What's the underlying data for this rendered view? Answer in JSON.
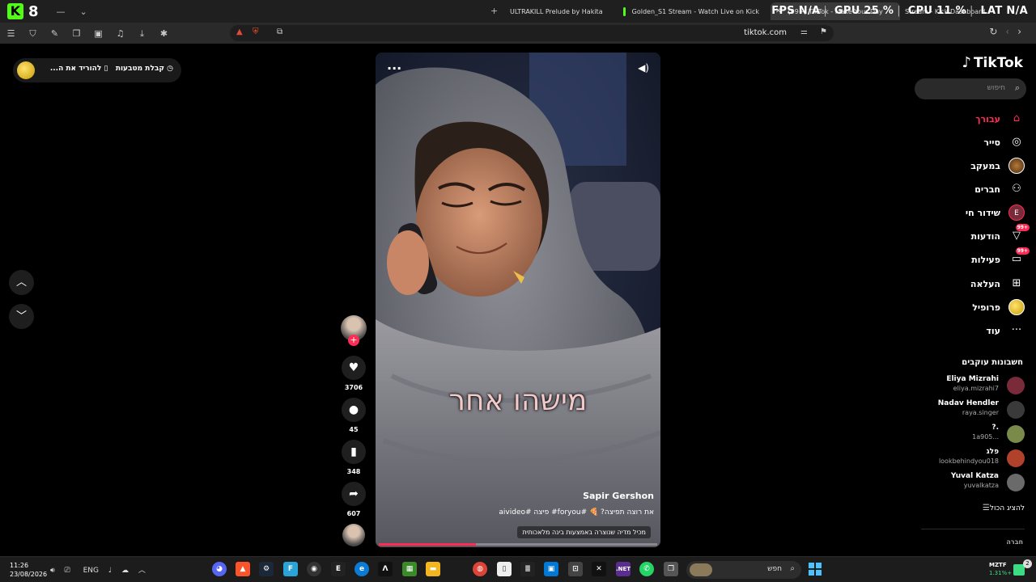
{
  "browser": {
    "kick_number": "8",
    "tabs": [
      {
        "label": "ULTRAKILL Prelude by Hakita",
        "color": "#9aa0a6"
      },
      {
        "label": "Golden_S1 Stream - Watch Live on Kick",
        "color": "#53fc18"
      },
      {
        "label": "(99+) TikTok - Make Your Day",
        "color": "#000000"
      },
      {
        "label": "Stream - Kick Dashboard",
        "color": "#53fc18"
      }
    ],
    "stats": {
      "fps_label": "FPS",
      "fps": "N/A",
      "gpu_label": "GPU",
      "gpu": "25 %",
      "cpu_label": "CPU",
      "cpu": "11 %",
      "lat_label": "LAT",
      "lat": "N/A"
    },
    "url": "tiktok.com"
  },
  "coin_pill": {
    "collect": "קבלת מטבעות",
    "download": "להוריד את ה..."
  },
  "video": {
    "caption": "מישהו אחר",
    "author": "Sapir Gershon",
    "description": "את רוצה תפיצה? 🍕 #foryou# פיצה #aivideo",
    "ai_notice": "מכיל מדיה שנוצרה באמצעות בינה מלאכותית",
    "progress": 0.35
  },
  "actions": {
    "likes": "3706",
    "comments": "45",
    "saves": "348",
    "shares": "607"
  },
  "sidebar": {
    "logo": "TikTok",
    "search_placeholder": "חיפוש",
    "items": [
      {
        "label": "עבורך",
        "icon": "home-icon",
        "glyph": "⌂"
      },
      {
        "label": "סייר",
        "icon": "compass-icon",
        "glyph": "◎"
      },
      {
        "label": "במעקב",
        "icon": "following-avatar-icon",
        "glyph": ""
      },
      {
        "label": "חברים",
        "icon": "friends-icon",
        "glyph": "⚇"
      },
      {
        "label": "שידור חי",
        "icon": "live-icon",
        "glyph": "E"
      },
      {
        "label": "הודעות",
        "icon": "messages-icon",
        "glyph": "▽",
        "badge": "99+"
      },
      {
        "label": "פעילות",
        "icon": "activity-icon",
        "glyph": "▭",
        "badge": "99+"
      },
      {
        "label": "העלאה",
        "icon": "upload-icon",
        "glyph": "⊞"
      },
      {
        "label": "פרופיל",
        "icon": "profile-icon",
        "glyph": ""
      },
      {
        "label": "עוד",
        "icon": "more-icon",
        "glyph": "···"
      }
    ],
    "following_title": "חשבונות עוקבים",
    "accounts": [
      {
        "name": "Eliya Mizrahi",
        "handle": "eliya.mizrahi7",
        "color": "#7a2b3a"
      },
      {
        "name": "Nadav Hendler",
        "handle": "raya.singer",
        "color": "#3a3a3a"
      },
      {
        "name": "?.",
        "handle": "1a905...",
        "color": "#7a8a4a"
      },
      {
        "name": "פלג",
        "handle": "lookbehindyou018",
        "color": "#b0412a"
      },
      {
        "name": "Yuval Katza",
        "handle": "yuvalkatza",
        "color": "#6a6a6a"
      }
    ],
    "show_all": "להציג הכול",
    "company": "חברה"
  },
  "taskbar": {
    "time": "11:26",
    "date": "23/08/2026",
    "lang": "ENG",
    "search_placeholder": "חפש",
    "ticker_name": "MZTF",
    "ticker_change": "1.31%+",
    "notif_count": "2"
  }
}
